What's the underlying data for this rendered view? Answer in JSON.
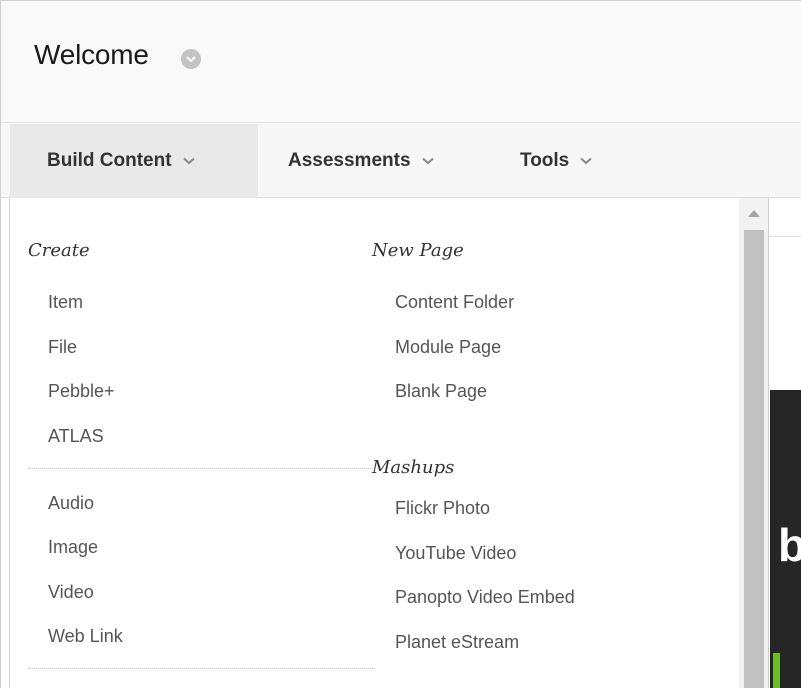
{
  "header": {
    "title": "Welcome",
    "options_icon": "chevron-down-circle-icon"
  },
  "action_bar": {
    "tabs": [
      {
        "label": "Build Content",
        "icon": "chevron-down-icon",
        "active": true
      },
      {
        "label": "Assessments",
        "icon": "chevron-down-icon",
        "active": false
      },
      {
        "label": "Tools",
        "icon": "chevron-down-icon",
        "active": false
      }
    ]
  },
  "dropdown": {
    "create": {
      "heading": "Create",
      "group1": [
        "Item",
        "File",
        "Pebble+",
        "ATLAS"
      ],
      "group2": [
        "Audio",
        "Image",
        "Video",
        "Web Link"
      ]
    },
    "new_page": {
      "heading": "New Page",
      "items": [
        "Content Folder",
        "Module Page",
        "Blank Page"
      ]
    },
    "mashups": {
      "heading": "Mashups",
      "items": [
        "Flickr Photo",
        "YouTube Video",
        "Panopto Video Embed",
        "Planet eStream"
      ]
    }
  },
  "background": {
    "partial_letter": "b"
  },
  "colors": {
    "active_tab_bg": "#e9e9e9",
    "dark_panel": "#262626",
    "accent_green": "#6bbd2c"
  }
}
